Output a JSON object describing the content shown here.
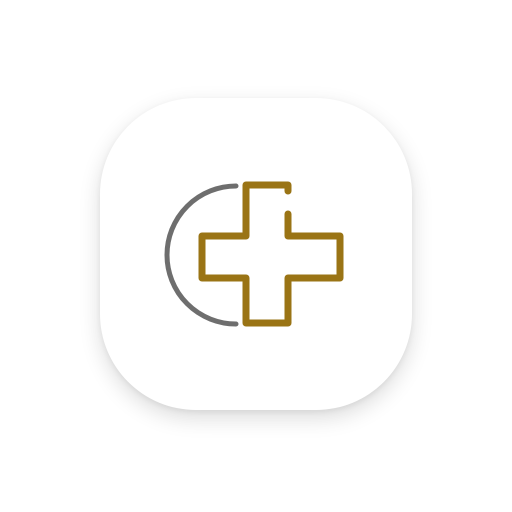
{
  "icon": {
    "name": "medical-cross-app-icon",
    "background_color": "#ffffff",
    "cross_color": "#9a7415",
    "arc_color": "#6e6e6e"
  }
}
